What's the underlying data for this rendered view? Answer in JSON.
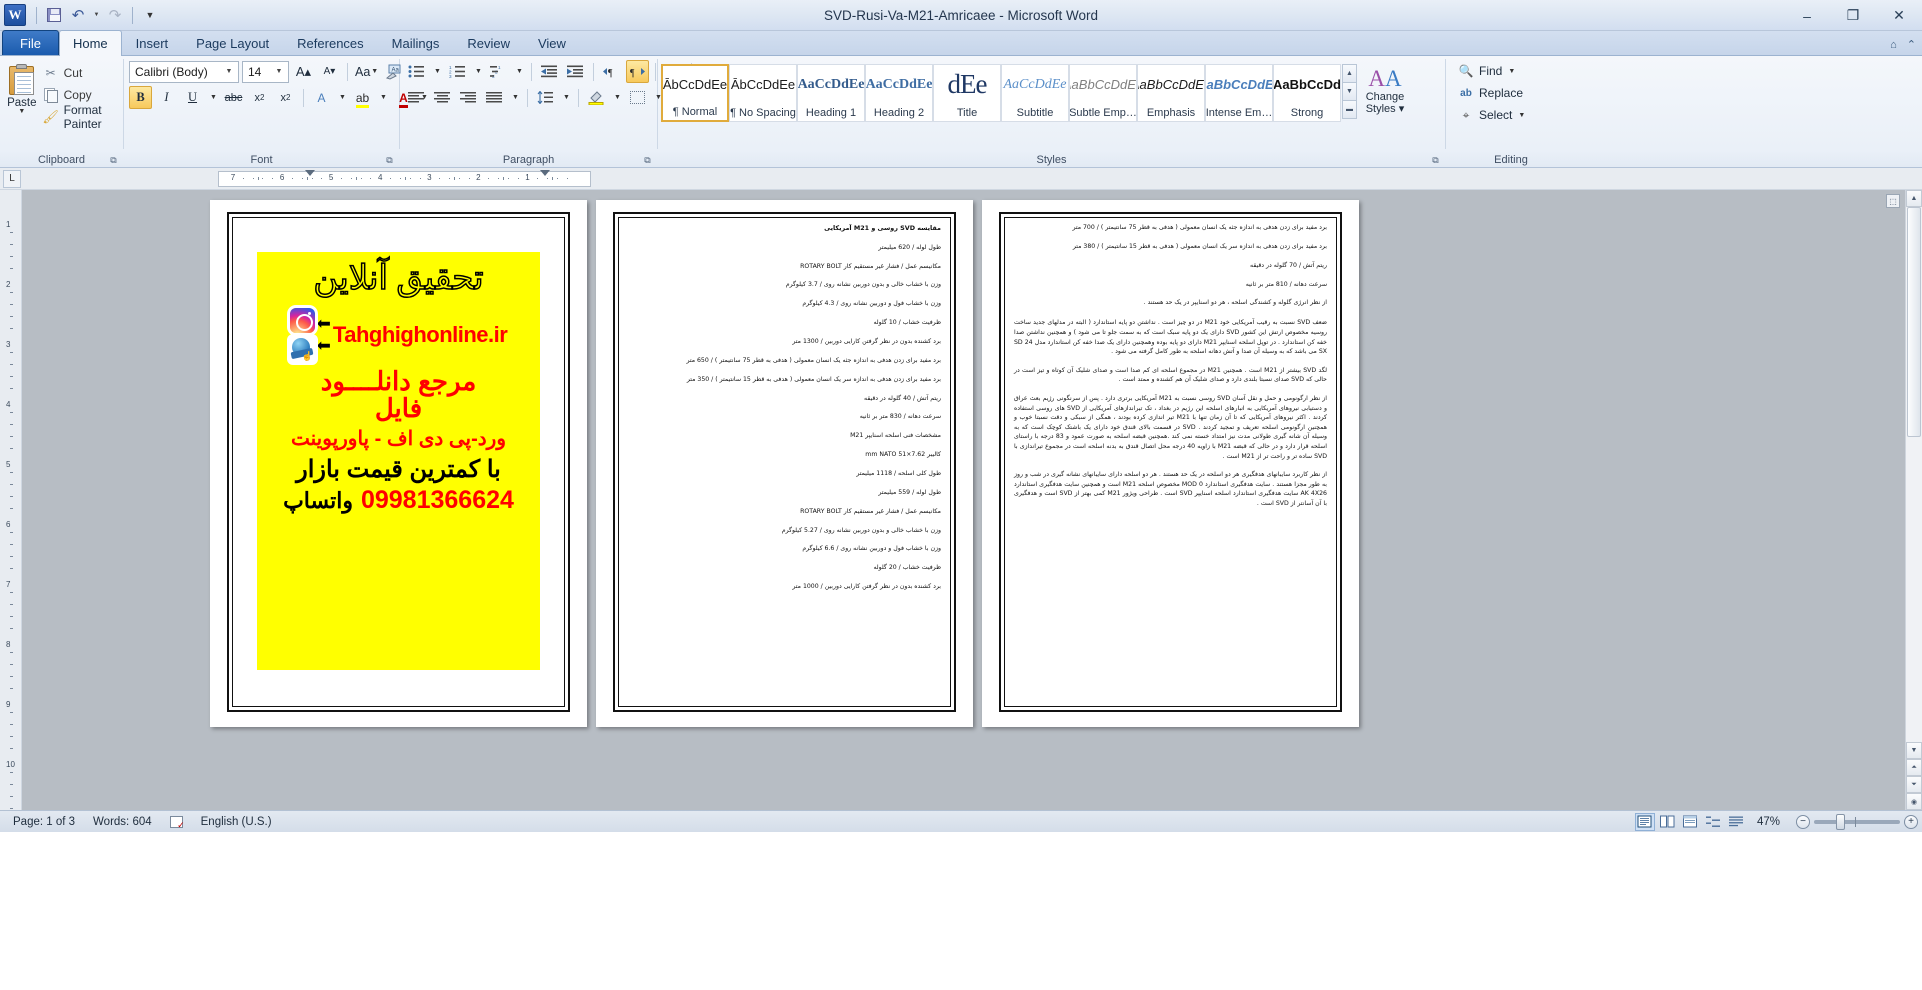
{
  "window": {
    "title": "SVD-Rusi-Va-M21-Amricaee  -  Microsoft Word",
    "app_logo": "W",
    "minimize": "–",
    "restore": "❐",
    "close": "✕"
  },
  "quick_access": {
    "save": "save-icon",
    "undo": "↶",
    "redo": "↷",
    "customize": "⌄"
  },
  "tabs": [
    {
      "label": "File",
      "id": "file"
    },
    {
      "label": "Home",
      "id": "home"
    },
    {
      "label": "Insert",
      "id": "insert"
    },
    {
      "label": "Page Layout",
      "id": "page-layout"
    },
    {
      "label": "References",
      "id": "references"
    },
    {
      "label": "Mailings",
      "id": "mailings"
    },
    {
      "label": "Review",
      "id": "review"
    },
    {
      "label": "View",
      "id": "view"
    }
  ],
  "ribbon": {
    "clipboard": {
      "group_label": "Clipboard",
      "paste": "Paste",
      "cut": "Cut",
      "copy": "Copy",
      "format_painter": "Format Painter"
    },
    "font": {
      "group_label": "Font",
      "font_name": "Calibri (Body)",
      "font_size": "14",
      "grow_font": "A",
      "shrink_font": "A",
      "change_case": "Aa",
      "clear_formatting": "clear-formatting-icon",
      "bold": "B",
      "italic": "I",
      "underline": "U",
      "strikethrough": "abc",
      "subscript": "x",
      "superscript": "x",
      "text_effects": "A",
      "highlight": "ab",
      "font_color": "A"
    },
    "paragraph": {
      "group_label": "Paragraph",
      "bullets": "bullets-icon",
      "numbering": "numbering-icon",
      "multilevel": "multilevel-list-icon",
      "decrease_indent": "decrease-indent-icon",
      "increase_indent": "increase-indent-icon",
      "ltr": "ltr-icon",
      "rtl": "rtl-icon",
      "sort": "sort-icon",
      "show_marks": "¶",
      "align_left": "align-left-icon",
      "align_center": "align-center-icon",
      "align_right": "align-right-icon",
      "justify": "justify-icon",
      "line_spacing": "line-spacing-icon",
      "shading": "shading-icon",
      "borders": "borders-icon"
    },
    "styles": {
      "group_label": "Styles",
      "items": [
        {
          "preview": "ĀbCcDdEe",
          "name": "¶ Normal",
          "selected": true
        },
        {
          "preview": "ĀbCcDdEe",
          "name": "¶ No Spacing",
          "selected": false
        },
        {
          "preview": "AaCcDdEe",
          "name": "Heading 1",
          "selected": false
        },
        {
          "preview": "AaCcDdEe",
          "name": "Heading 2",
          "selected": false
        },
        {
          "preview": "dEe",
          "name": "Title",
          "selected": false
        },
        {
          "preview": "AaCcDdEe",
          "name": "Subtitle",
          "selected": false
        },
        {
          "preview": "AaBbCcDdEe",
          "name": "Subtle Emp…",
          "selected": false
        },
        {
          "preview": "AaBbCcDdEe",
          "name": "Emphasis",
          "selected": false
        },
        {
          "preview": "AaBbCcDdEe",
          "name": "Intense Em…",
          "selected": false
        },
        {
          "preview": "AaBbCcDd",
          "name": "Strong",
          "selected": false
        }
      ],
      "change_styles": "Change",
      "change_styles2": "Styles"
    },
    "editing": {
      "group_label": "Editing",
      "find": "Find",
      "replace": "Replace",
      "select": "Select"
    }
  },
  "ruler": {
    "tab_stop_button": "L",
    "numbers": [
      "7",
      "6",
      "5",
      "4",
      "3",
      "2",
      "1"
    ]
  },
  "document": {
    "page1": {
      "flyer": {
        "title": "تحقیق آنلاین",
        "url": "Tahghighonline.ir",
        "line1": "مرجع دانلــــود",
        "line2": "فایل",
        "line3": "ورد-پی دی اف - پاورپوینت",
        "line4": "با کمترین قیمت بازار",
        "phone": "09981366624",
        "whatsapp": "واتساپ",
        "instagram_icon": "instagram-icon",
        "website_icon": "website-icon",
        "arrow": "arrow-left-icon"
      }
    },
    "page2": {
      "title": "مقایسه SVD روسی و M21 آمریکایی",
      "lines": [
        "طول لوله / 620 میلیمتر",
        "مکانیسم عمل / فشار غیر مستقیم کار ROTARY BOLT",
        "وزن با خشاب خالی و بدون دوربین نشانه روی / 3.7 کیلوگرم",
        "وزن با خشاب فول و دوربین نشانه روی / 4.3 کیلوگرم",
        "ظرفیت خشاب / 10 گلوله",
        "برد کشنده بدون در نظر گرفتن کارایی دوربین / 1300 متر",
        "برد مفید برای زدن هدفی به اندازه جثه یک انسان معمولی ( هدفی به قطر 75 سانتیمتر ) / 650 متر",
        "برد مفید برای زدن هدفی به اندازه سر یک انسان معمولی ( هدفی به قطر 15 سانتیمتر ) / 350 متر",
        "ریتم آتش / 40 گلوله در دقیقه",
        "سرعت دهانه / 830 متر بر ثانیه",
        "مشخصات فنی اسلحه اسنایپر M21",
        "کالیبر mm NATO 51×7.62",
        "طول کلی اسلحه / 1118 میلیمتر",
        "طول لوله / 559 میلیمتر",
        "مکانیسم عمل / فشار غیر مستقیم کار ROTARY BOLT",
        "وزن با خشاب خالی و بدون دوربین نشانه روی / 5.27 کیلوگرم",
        "وزن با خشاب فول و دوربین نشانه روی / 6.6 کیلوگرم",
        "ظرفیت خشاب / 20 گلوله",
        "برد کشنده بدون در نظر گرفتن کارایی دوربین / 1000 متر"
      ]
    },
    "page3": {
      "lines": [
        "برد مفید برای زدن هدفی به اندازه جثه یک انسان معمولی ( هدفی به قطر 75 سانتیمتر ) / 700 متر",
        "برد مفید برای زدن هدفی به اندازه سر یک انسان معمولی ( هدفی به قطر 15 سانتیمتر ) / 380 متر",
        "ریتم آتش / 70 گلوله در دقیقه",
        "سرعت دهانه / 810 متر بر ثانیه",
        "از نظر انرژی گلوله و کشندگی اسلحه ، هر دو اسنایپر در یک حد هستند ."
      ],
      "paragraphs": [
        "ضعف SVD نسبت به رقیب آمریکایی خود M21 در دو چیز است . نداشتن دو پایه استاندارد ( البته در مدلهای جدید ساخت روسیه مخصوص ارتش این کشور SVD دارای یک دو پایه سبک است که به سمت جلو تا می شود ) و همچنین نداشتن صدا خفه کن استاندارد . در توپل اسلحه اسنایپر M21 دارای دو پایه بوده وهمچنین دارای یک صدا خفه کن استاندارد مدل SD 24 SX می باشد که به وسیله آن صدا و آتش دهانه اسلحه به طور کامل گرفته می شود .",
        "لگد SVD بیشتر از M21 است . همچنین M21 در مجموع اسلحه ای کم صدا است و صدای شلیک آن کوتاه و تیز است در حالی که SVD صدای نسبتا بلندی دارد و صدای شلیک آن هم کشنده و ممتد است .",
        "از نظر ارگونومی و حمل و نقل آسان SVD روسی نسبت به M21 آمریکایی برتری دارد . پس از سرنگونی رژیم بعث عراق و دستیابی نیروهای آمریکایی به انبارهای اسلحه این رژیم در بغداد ، تک تیراندازهای آمریکایی از SVD های روسی استفاده کردند . اکثر نیروهای آمریکایی که تا آن زمان تنها با M21 تیر اندازی کرده بودند ، همگی از سبکی و دقت نسبتا خوب و همچنین ارگونومی اسلحه تعریف و تمجید کردند . SVD در قسمت بالای قندق خود دارای یک باشتک کوچک است که به وسیله آن شانه گیری طولانی مدت نیز امتداد خسته نمی کند .همچنین قبضه اسلحه به صورت عمود و 83 درجه با راستای اسلحه قرار دارد و در حالی که قبضه M21 با زاویه 40 درجه محل اتصال قندق به بدنه اسلحه است در مجموع تیراندازی با SVD ساده تر و راحت تر از M21 است .",
        "از نظر کاربرد سایبانهای هدفگیری هر دو اسلحه در یک حد هستند . هر دو اسلحه دارای سایبانهای نشانه گیری در شب و روز به طور مجزا هستند . سایت هدفگیری استاندارد MOD 0 مخصوص اسلحه M21 است و همچنین سایت هدفگیری استاندارد AK 4X26 سایت هدفگیری استاندارد اسلحه اسنایپر SVD است . طراحی ویژور M21 کمی بهتر از SVD است و هدفگیری با آن آسانتر از SVD است ."
      ]
    }
  },
  "status_bar": {
    "page": "Page: 1 of 3",
    "words": "Words: 604",
    "language": "English (U.S.)",
    "spell_icon": "spell-check-icon",
    "zoom_value": "47%",
    "view_buttons": [
      "print-layout-icon",
      "full-screen-reading-icon",
      "web-layout-icon",
      "outline-icon",
      "draft-icon"
    ]
  }
}
